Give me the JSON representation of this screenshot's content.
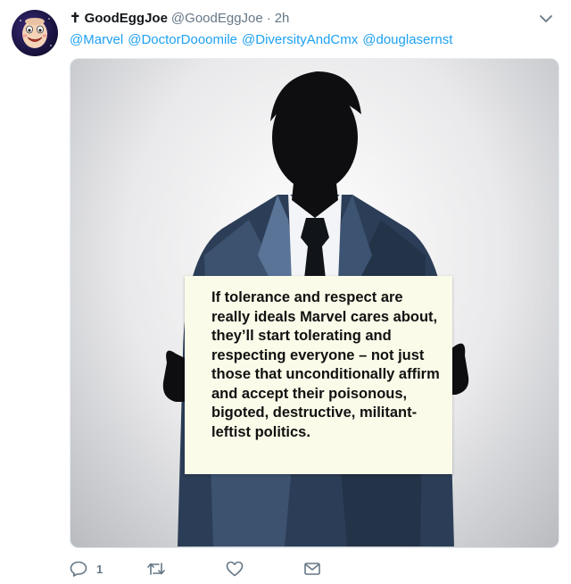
{
  "tweet": {
    "cross_glyph": "✝",
    "display_name": "GoodEggJoe",
    "handle": "@GoodEggJoe",
    "separator": "·",
    "timestamp": "2h",
    "mentions": [
      "@Marvel",
      "@DoctorDooomile",
      "@DiversityAndCmx",
      "@douglasernst"
    ],
    "media": {
      "sign_text": "If tolerance and respect are really ideals Marvel cares about, they’ll start tolerating and respecting everyone – not just those that unconditionally affirm and accept their poisonous, bigoted, destructive, militant-leftist politics."
    },
    "actions": {
      "reply_count": "1"
    }
  },
  "icons": {
    "avatar": "cartoon-egg-avatar",
    "menu": "chevron-down-icon",
    "reply": "reply-icon",
    "retweet": "retweet-icon",
    "like": "heart-icon",
    "dm": "envelope-icon"
  },
  "colors": {
    "link": "#1da1f2",
    "secondary_text": "#657786",
    "primary_text": "#14171a",
    "sign": "#fbfbe9"
  }
}
